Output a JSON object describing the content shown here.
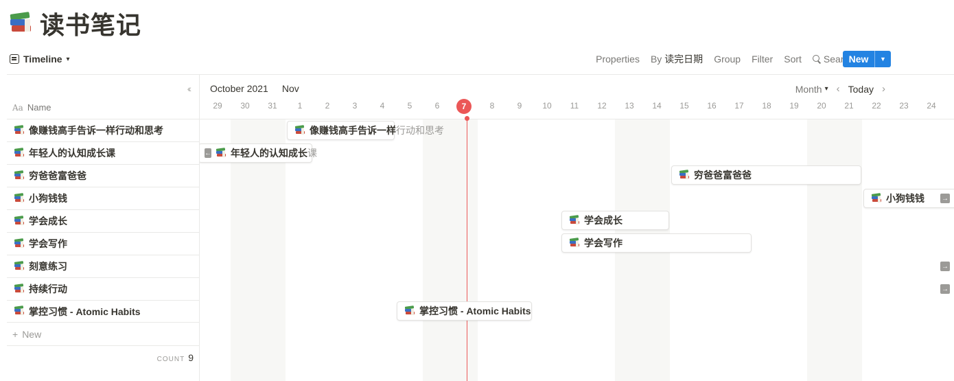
{
  "page": {
    "title": "读书笔记",
    "icon": "books-icon"
  },
  "toolbar": {
    "view_name": "Timeline",
    "properties": "Properties",
    "by_prefix": "By",
    "by_field": "读完日期",
    "group": "Group",
    "filter": "Filter",
    "sort": "Sort",
    "search": "Search",
    "more": "•••",
    "new_label": "New",
    "new_arrow": "⌄"
  },
  "table": {
    "name_header": "Name",
    "name_icon": "Aa",
    "rows": [
      {
        "name": "像赚钱高手告诉一样行动和思考"
      },
      {
        "name": "年轻人的认知成长课"
      },
      {
        "name": "穷爸爸富爸爸"
      },
      {
        "name": "小狗钱钱"
      },
      {
        "name": "学会成长"
      },
      {
        "name": "学会写作"
      },
      {
        "name": "刻意练习"
      },
      {
        "name": "持续行动"
      },
      {
        "name": "掌控习惯 - Atomic Habits"
      }
    ],
    "add_label": "New",
    "count_label": "COUNT",
    "count_value": "9"
  },
  "timeline": {
    "month_primary": "October 2021",
    "month_secondary": "Nov",
    "zoom": "Month",
    "today_label": "Today",
    "today_day": "7",
    "days": [
      "29",
      "30",
      "31",
      "1",
      "2",
      "3",
      "4",
      "5",
      "6",
      "7",
      "8",
      "9",
      "10",
      "11",
      "12",
      "13",
      "14",
      "15",
      "16",
      "17",
      "18",
      "19",
      "20",
      "21",
      "22",
      "23",
      "24"
    ],
    "bars": {
      "b1_name": "像赚钱高手告诉一样",
      "b1_overflow": "行动和思考",
      "b2_name": "年轻人的认知成长",
      "b2_overflow": "课",
      "b3_name": "穷爸爸富爸爸",
      "b4_name": "小狗钱钱",
      "b5_name": "学会成长",
      "b6_name": "学会写作",
      "b9_name": "掌控习惯 - Atomic Habits"
    }
  },
  "colors": {
    "accent": "#2383e2",
    "today": "#eb5757",
    "text": "#37352f",
    "muted": "#9b9a97"
  }
}
